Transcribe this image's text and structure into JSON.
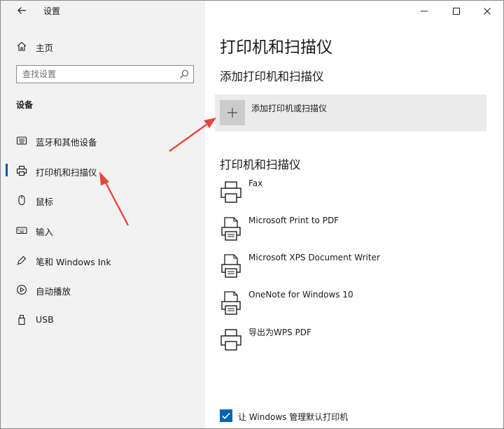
{
  "window": {
    "title": "设置",
    "back_icon": "arrow-left-icon"
  },
  "window_controls": [
    "minimize-icon",
    "maximize-icon",
    "close-icon"
  ],
  "sidebar": {
    "home_label": "主页",
    "search_placeholder": "查找设置",
    "section_title": "设备",
    "items": [
      {
        "label": "蓝牙和其他设备",
        "icon": "bluetooth-devices-icon",
        "selected": false
      },
      {
        "label": "打印机和扫描仪",
        "icon": "printer-icon",
        "selected": true
      },
      {
        "label": "鼠标",
        "icon": "mouse-icon",
        "selected": false
      },
      {
        "label": "输入",
        "icon": "keyboard-icon",
        "selected": false
      },
      {
        "label": "笔和 Windows Ink",
        "icon": "pen-icon",
        "selected": false
      },
      {
        "label": "自动播放",
        "icon": "autoplay-icon",
        "selected": false
      },
      {
        "label": "USB",
        "icon": "usb-icon",
        "selected": false
      }
    ]
  },
  "main": {
    "title": "打印机和扫描仪",
    "add_section_title": "添加打印机和扫描仪",
    "add_button_label": "添加打印机或扫描仪",
    "list_title": "打印机和扫描仪",
    "printers": [
      {
        "name": "Fax",
        "icon": "printer-icon"
      },
      {
        "name": "Microsoft Print to PDF",
        "icon": "document-printer-icon"
      },
      {
        "name": "Microsoft XPS Document Writer",
        "icon": "document-printer-icon"
      },
      {
        "name": "OneNote for Windows 10",
        "icon": "document-printer-icon"
      },
      {
        "name": "导出为WPS PDF",
        "icon": "printer-icon"
      }
    ],
    "manage_default_label": "让 Windows 管理默认打印机",
    "manage_default_checked": true
  },
  "colors": {
    "accent": "#0063b1",
    "annotation_arrow": "#e8463c",
    "sidebar_bg": "#f2f2f2"
  }
}
